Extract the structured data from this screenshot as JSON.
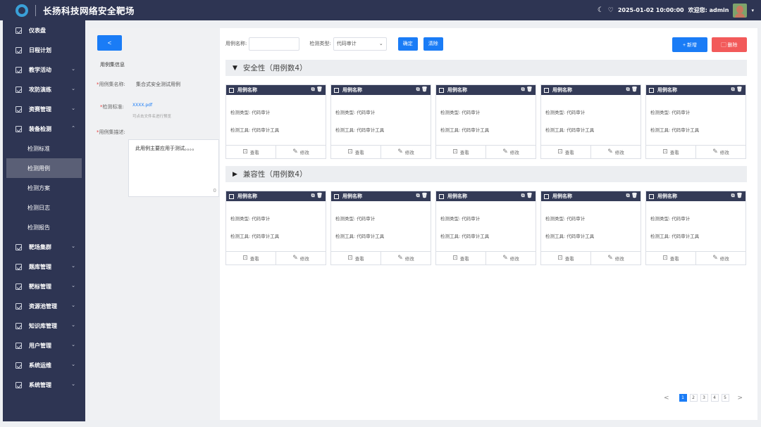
{
  "app": {
    "title": "长扬科技网络安全靶场"
  },
  "header": {
    "datetime": "2025-01-02 10:00:00",
    "welcome": "欢迎您: admin",
    "moon_icon": "☾",
    "bell_icon": "🔔"
  },
  "sidebar": {
    "items": [
      {
        "label": "仪表盘"
      },
      {
        "label": "日程计划"
      },
      {
        "label": "教学活动",
        "chev": "⌄"
      },
      {
        "label": "攻防演练",
        "chev": "⌄"
      },
      {
        "label": "资赛管理",
        "chev": "⌄"
      },
      {
        "label": "装备检测",
        "chev": "⌃"
      }
    ],
    "sub_items": [
      {
        "label": "检测标准"
      },
      {
        "label": "检测用例"
      },
      {
        "label": "检测方案"
      },
      {
        "label": "检测日志"
      },
      {
        "label": "检测报告"
      }
    ],
    "items2": [
      {
        "label": "靶场集群",
        "chev": "⌄"
      },
      {
        "label": "题库管理",
        "chev": "⌄"
      },
      {
        "label": "靶标管理",
        "chev": "⌄"
      },
      {
        "label": "资源池管理",
        "chev": "⌄"
      },
      {
        "label": "知识库管理",
        "chev": "⌄"
      },
      {
        "label": "用户管理",
        "chev": "⌄"
      },
      {
        "label": "系统运维",
        "chev": "⌄"
      },
      {
        "label": "系统管理",
        "chev": "⌄"
      }
    ]
  },
  "left_panel": {
    "back_label": "<",
    "section_title": "用例集信息",
    "name_label": "用例集名称:",
    "name_value": "集合式安全测试用例",
    "standard_label": "检测标准:",
    "standard_file": "XXXX.pdf",
    "standard_hint": "可点击文件名进行预览",
    "desc_label": "用例集描述:",
    "desc_value": "此用例主要应用于测试。。。。",
    "desc_count": "0"
  },
  "filters": {
    "name_label": "用例名称:",
    "name_value": "",
    "type_label": "检测类型:",
    "type_value": "代码审计",
    "confirm": "确定",
    "clear": "清除"
  },
  "actions": {
    "add": "+ 新增",
    "delete": "删除"
  },
  "groups": [
    {
      "title": "安全性（用例数4）"
    },
    {
      "title": "兼容性（用例数4）"
    }
  ],
  "card": {
    "name": "用例名称",
    "type_line": "检测类型: 代码审计",
    "tool_line": "检测工具: 代码审计工具",
    "view": "查看",
    "edit": "修改",
    "icons": "⧉ 🗑"
  },
  "pagination": {
    "pages": [
      "1",
      "2",
      "3",
      "4",
      "5"
    ],
    "prev": "<",
    "next": ">"
  }
}
